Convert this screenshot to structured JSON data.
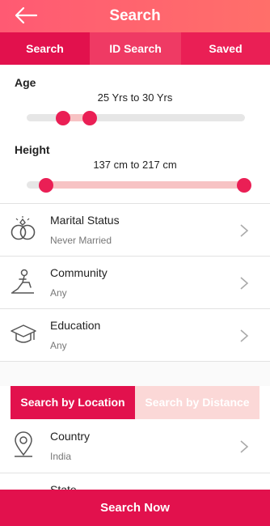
{
  "header": {
    "title": "Search"
  },
  "tabs": [
    {
      "label": "Search",
      "active": true
    },
    {
      "label": "ID Search",
      "active": false
    },
    {
      "label": "Saved",
      "active": false
    }
  ],
  "age": {
    "label": "Age",
    "range_text": "25 Yrs to 30 Yrs",
    "min": 25,
    "max": 30
  },
  "height": {
    "label": "Height",
    "range_text": "137 cm to 217 cm",
    "min": 137,
    "max": 217
  },
  "filters": [
    {
      "title": "Marital Status",
      "value": "Never Married",
      "icon": "rings-icon"
    },
    {
      "title": "Community",
      "value": "Any",
      "icon": "praying-person-icon"
    },
    {
      "title": "Education",
      "value": "Any",
      "icon": "graduation-cap-icon"
    }
  ],
  "location_toggle": {
    "by_location": "Search by Location",
    "by_distance": "Search by Distance",
    "active": "by_location"
  },
  "location_filters": [
    {
      "title": "Country",
      "value": "India",
      "icon": "location-pin-icon"
    },
    {
      "title": "State",
      "value": "",
      "icon": ""
    }
  ],
  "actions": {
    "search_now": "Search Now"
  },
  "colors": {
    "accent": "#e2114d",
    "header": "#ff5a73",
    "inactive_toggle": "#fbd8d7"
  }
}
